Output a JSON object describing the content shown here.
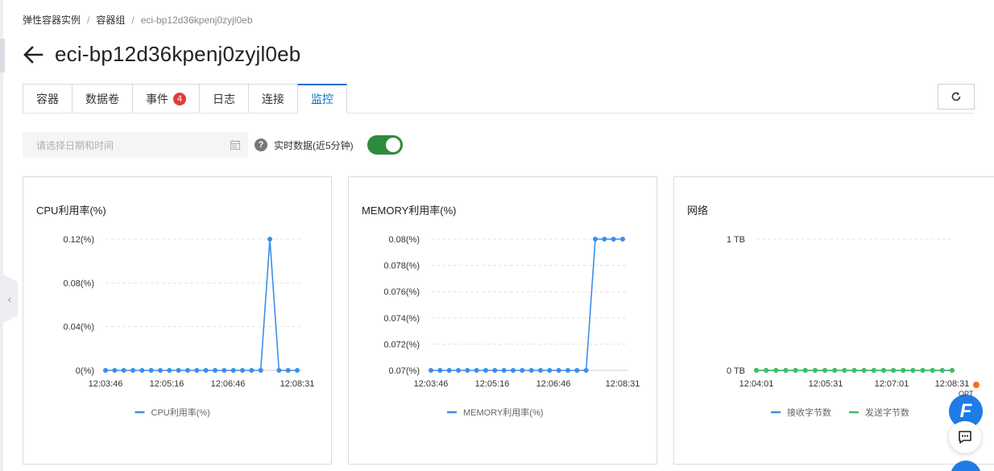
{
  "breadcrumb": [
    "弹性容器实例",
    "容器组",
    "eci-bp12d36kpenj0zyjl0eb"
  ],
  "title": "eci-bp12d36kpenj0zyjl0eb",
  "tabs": [
    {
      "label": "容器"
    },
    {
      "label": "数据卷"
    },
    {
      "label": "事件",
      "badge": "4"
    },
    {
      "label": "日志"
    },
    {
      "label": "连接"
    },
    {
      "label": "监控",
      "active": true
    }
  ],
  "toolbar": {
    "date_placeholder": "请选择日期和时间",
    "realtime_label": "实时数据(近5分钟)",
    "realtime_on": true
  },
  "float_widget": {
    "label": "OPT"
  },
  "colors": {
    "accent": "#0070cc",
    "series_blue": "#3b8ee8",
    "series_green": "#3cc05a",
    "toggle": "#2e8b3e",
    "badge": "#e03c3c"
  },
  "charts": [
    {
      "title": "CPU利用率(%)",
      "chart_data": {
        "type": "line",
        "title": "CPU利用率(%)",
        "x_ticks": [
          "12:03:46",
          "12:05:16",
          "12:06:46",
          "12:08:31"
        ],
        "y_ticks": [
          "0.12(%)",
          "0.08(%)",
          "0.04(%)",
          "0(%)"
        ],
        "ylim": [
          0,
          0.12
        ],
        "series": [
          {
            "name": "CPU利用率(%)",
            "color": "#3b8ee8",
            "values": [
              0,
              0,
              0,
              0,
              0,
              0,
              0,
              0,
              0,
              0,
              0,
              0,
              0,
              0,
              0,
              0,
              0,
              0,
              0.12,
              0,
              0,
              0
            ]
          }
        ]
      }
    },
    {
      "title": "MEMORY利用率(%)",
      "chart_data": {
        "type": "line",
        "title": "MEMORY利用率(%)",
        "x_ticks": [
          "12:03:46",
          "12:05:16",
          "12:06:46",
          "12:08:31"
        ],
        "y_ticks": [
          "0.08(%)",
          "0.078(%)",
          "0.076(%)",
          "0.074(%)",
          "0.072(%)",
          "0.07(%)"
        ],
        "ylim": [
          0.07,
          0.08
        ],
        "series": [
          {
            "name": "MEMORY利用率(%)",
            "color": "#3b8ee8",
            "values": [
              0.07,
              0.07,
              0.07,
              0.07,
              0.07,
              0.07,
              0.07,
              0.07,
              0.07,
              0.07,
              0.07,
              0.07,
              0.07,
              0.07,
              0.07,
              0.07,
              0.07,
              0.07,
              0.08,
              0.08,
              0.08,
              0.08
            ]
          }
        ]
      }
    },
    {
      "title": "网络",
      "chart_data": {
        "type": "line",
        "title": "网络",
        "x_ticks": [
          "12:04:01",
          "12:05:31",
          "12:07:01",
          "12:08:31"
        ],
        "y_ticks": [
          "1 TB",
          "0 TB"
        ],
        "ylim": [
          0,
          1
        ],
        "series": [
          {
            "name": "接收字节数",
            "color": "#3b8ee8",
            "values": [
              0,
              0,
              0,
              0,
              0,
              0,
              0,
              0,
              0,
              0,
              0,
              0,
              0,
              0,
              0,
              0,
              0,
              0,
              0,
              0,
              0
            ]
          },
          {
            "name": "发送字节数",
            "color": "#3cc05a",
            "values": [
              0,
              0,
              0,
              0,
              0,
              0,
              0,
              0,
              0,
              0,
              0,
              0,
              0,
              0,
              0,
              0,
              0,
              0,
              0,
              0,
              0
            ]
          }
        ]
      }
    }
  ]
}
